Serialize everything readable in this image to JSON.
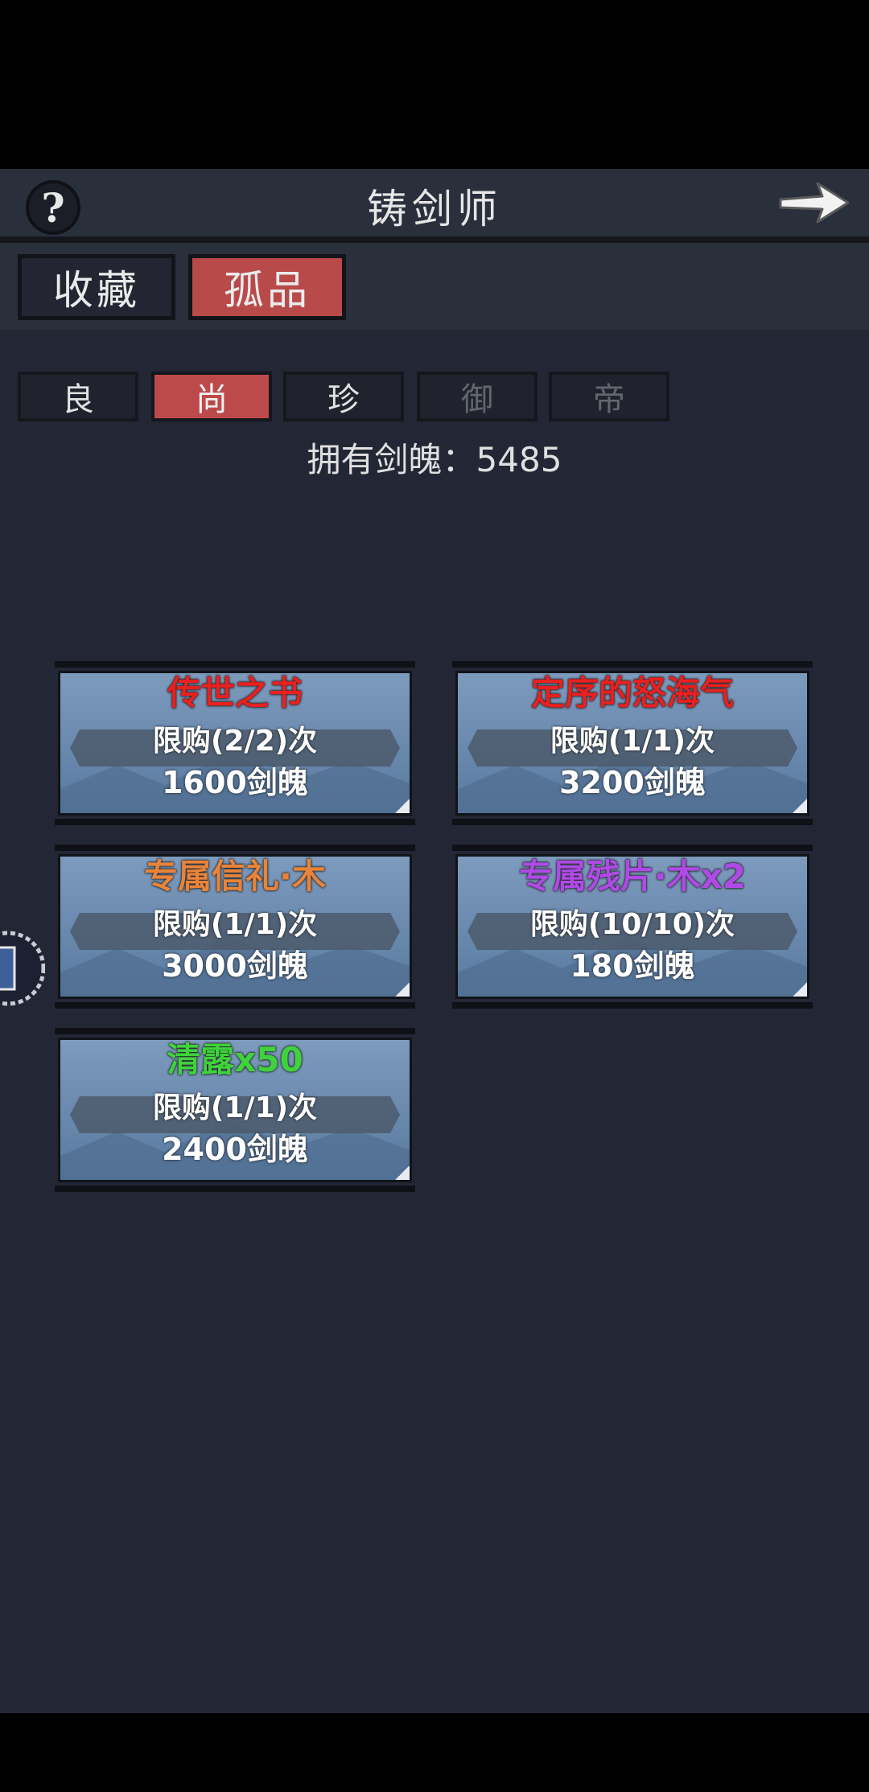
{
  "header": {
    "title": "铸剑师",
    "help_label": "?"
  },
  "main_tabs": [
    {
      "label": "收藏",
      "active": false
    },
    {
      "label": "孤品",
      "active": true
    }
  ],
  "rarity_tabs": [
    {
      "label": "良",
      "state": "normal"
    },
    {
      "label": "尚",
      "state": "active"
    },
    {
      "label": "珍",
      "state": "normal"
    },
    {
      "label": "御",
      "state": "dim"
    },
    {
      "label": "帝",
      "state": "dim"
    }
  ],
  "currency": {
    "text": "拥有剑魄：5485"
  },
  "items": [
    {
      "name": "传世之书",
      "name_color": "#e8201f",
      "limit": "限购(2/2)次",
      "price": "1600剑魄"
    },
    {
      "name": "定序的怒海气",
      "name_color": "#e8201f",
      "limit": "限购(1/1)次",
      "price": "3200剑魄"
    },
    {
      "name": "专属信礼·木",
      "name_color": "#e8843a",
      "limit": "限购(1/1)次",
      "price": "3000剑魄"
    },
    {
      "name": "专属残片·木x2",
      "name_color": "#b04ae6",
      "limit": "限购(10/10)次",
      "price": "180剑魄"
    },
    {
      "name": "清露x50",
      "name_color": "#3fd23c",
      "limit": "限购(1/1)次",
      "price": "2400剑魄"
    }
  ],
  "colors": {
    "background": "#242835",
    "active_tab": "#bd4a4a",
    "card": "#7d9bbd"
  }
}
